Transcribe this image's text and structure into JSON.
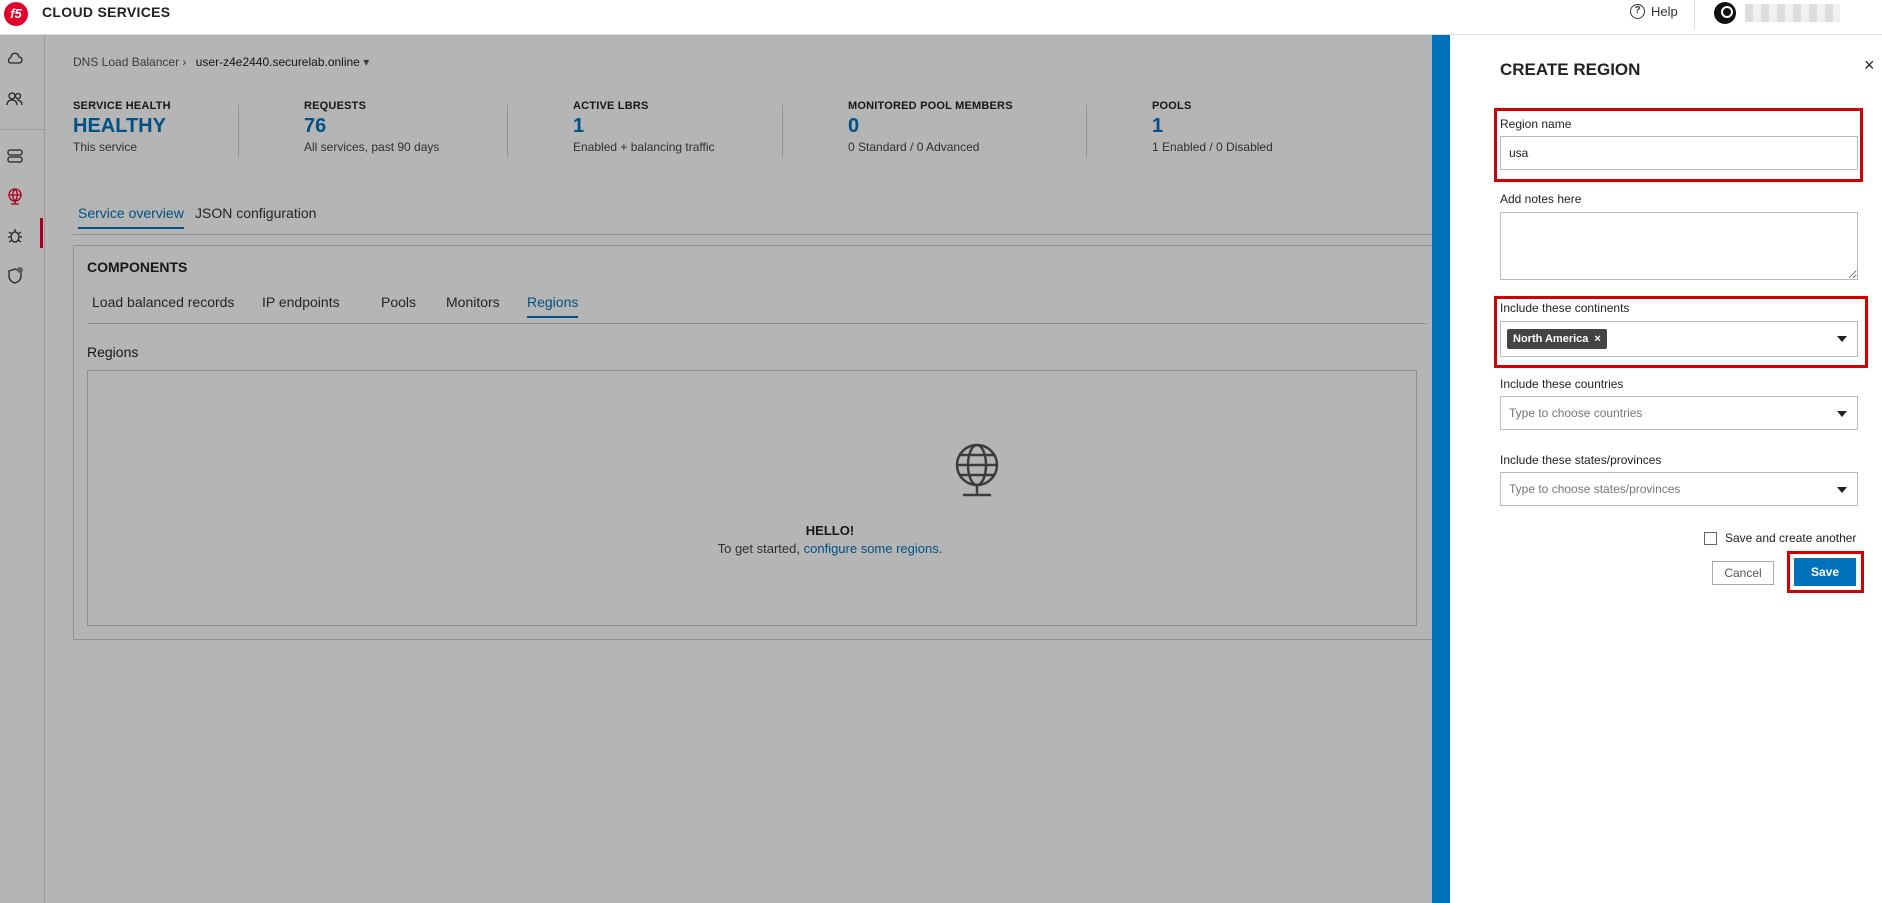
{
  "app": {
    "brand": "CLOUD SERVICES",
    "logo_text": "f5",
    "help_label": "Help"
  },
  "breadcrumb": {
    "parent": "DNS Load Balancer",
    "current": "user-z4e2440.securelab.online"
  },
  "stats": [
    {
      "title": "SERVICE HEALTH",
      "value": "HEALTHY",
      "sub": "This service"
    },
    {
      "title": "REQUESTS",
      "value": "76",
      "sub": "All services, past 90 days"
    },
    {
      "title": "ACTIVE LBRS",
      "value": "1",
      "sub": "Enabled + balancing traffic"
    },
    {
      "title": "MONITORED POOL MEMBERS",
      "value": "0",
      "sub": "0 Standard / 0 Advanced"
    },
    {
      "title": "POOLS",
      "value": "1",
      "sub": "1 Enabled / 0 Disabled"
    }
  ],
  "main_tabs": [
    {
      "label": "Service overview",
      "active": true
    },
    {
      "label": "JSON configuration",
      "active": false
    }
  ],
  "components": {
    "title": "COMPONENTS",
    "tabs": [
      {
        "label": "Load balanced records",
        "active": false
      },
      {
        "label": "IP endpoints",
        "active": false
      },
      {
        "label": "Pools",
        "active": false
      },
      {
        "label": "Monitors",
        "active": false
      },
      {
        "label": "Regions",
        "active": true
      }
    ],
    "section_label": "Regions",
    "empty": {
      "hello": "HELLO!",
      "prefix": "To get started, ",
      "link": "configure some regions",
      "suffix": "."
    }
  },
  "panel": {
    "title": "CREATE REGION",
    "close": "×",
    "region_name_label": "Region name",
    "region_name_value": "usa",
    "notes_label": "Add notes here",
    "continents_label": "Include these continents",
    "continent_chip": "North America",
    "chip_remove": "×",
    "countries_label": "Include these countries",
    "countries_placeholder": "Type to choose countries",
    "states_label": "Include these states/provinces",
    "states_placeholder": "Type to choose states/provinces",
    "save_another_label": "Save and create another",
    "cancel_label": "Cancel",
    "save_label": "Save"
  },
  "colors": {
    "accent": "#0072bc",
    "brand_red": "#e4002b",
    "highlight": "#d40000"
  }
}
